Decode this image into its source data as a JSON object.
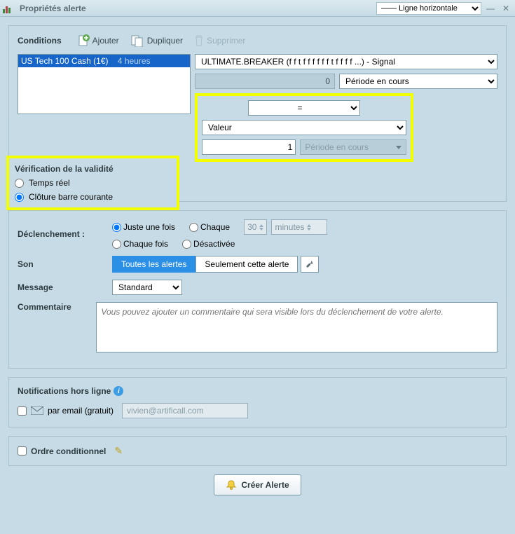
{
  "titlebar": {
    "title": "Propriétés alerte",
    "linetype": "—— Ligne horizontale"
  },
  "toolbar": {
    "heading": "Conditions",
    "add": "Ajouter",
    "duplicate": "Dupliquer",
    "delete": "Supprimer"
  },
  "instrument": {
    "name": "US Tech 100 Cash (1€)",
    "timeframe": "4 heures",
    "indicator": "ULTIMATE.BREAKER (f f t f f f f f f t f f f f ...)  - Signal",
    "offset1": "0",
    "period1": "Période en cours",
    "operator": "=",
    "compare_to": "Valeur",
    "value2": "1",
    "period2": "Période en cours"
  },
  "validity": {
    "heading": "Vérification de la validité",
    "realtime": "Temps réel",
    "barclose": "Clôture barre courante"
  },
  "trigger": {
    "label": "Déclenchement :",
    "once": "Juste une fois",
    "each": "Chaque",
    "each_value": "30",
    "each_unit": "minutes",
    "every_time": "Chaque fois",
    "disabled": "Désactivée"
  },
  "sound": {
    "label": "Son",
    "all": "Toutes les alertes",
    "only": "Seulement cette alerte"
  },
  "message": {
    "label": "Message",
    "value": "Standard"
  },
  "comment": {
    "label": "Commentaire",
    "placeholder": "Vous pouvez ajouter un commentaire qui sera visible lors du déclenchement de votre alerte."
  },
  "notifications": {
    "heading": "Notifications hors ligne",
    "email_label": "par email (gratuit)",
    "email_value": "vivien@artificall.com"
  },
  "conditional": {
    "label": "Ordre conditionnel"
  },
  "create": "Créer Alerte"
}
